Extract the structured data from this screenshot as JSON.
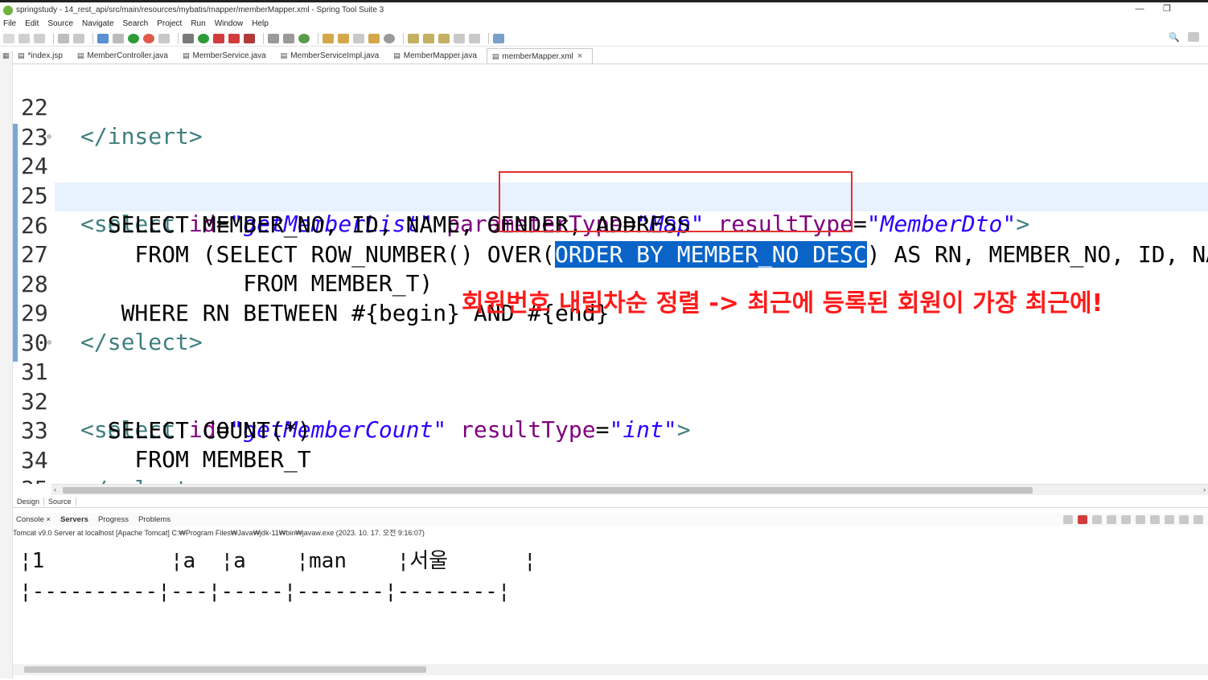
{
  "window": {
    "title": "springstudy - 14_rest_api/src/main/resources/mybatis/mapper/memberMapper.xml - Spring Tool Suite 3",
    "controls": [
      "—",
      "❐",
      ""
    ]
  },
  "menu": [
    "File",
    "Edit",
    "Source",
    "Navigate",
    "Search",
    "Project",
    "Run",
    "Window",
    "Help"
  ],
  "tabs": [
    {
      "label": "*index.jsp",
      "icon": "jsp-file-icon",
      "active": false
    },
    {
      "label": "MemberController.java",
      "icon": "java-file-icon",
      "active": false
    },
    {
      "label": "MemberService.java",
      "icon": "java-file-icon",
      "active": false
    },
    {
      "label": "MemberServiceImpl.java",
      "icon": "java-file-icon",
      "active": false
    },
    {
      "label": "MemberMapper.java",
      "icon": "java-file-icon",
      "active": false
    },
    {
      "label": "memberMapper.xml",
      "icon": "xml-file-icon",
      "active": true
    }
  ],
  "editor": {
    "lines": [
      {
        "n": "22",
        "code": "</insert>"
      },
      {
        "n": "23",
        "code": ""
      },
      {
        "n": "24",
        "code": "<select id=\"getMemberList\" parameterType=\"Map\" resultType=\"MemberDto\">"
      },
      {
        "n": "25",
        "code": "  SELECT MEMBER_NO, ID, NAME, GENDER, ADDRESS"
      },
      {
        "n": "26",
        "code": "    FROM (SELECT ROW_NUMBER() OVER(ORDER BY MEMBER_NO DESC) AS RN, MEMBER_NO, ID, NAME,"
      },
      {
        "n": "27",
        "code": "            FROM MEMBER_T)"
      },
      {
        "n": "28",
        "code": "   WHERE RN BETWEEN #{begin} AND #{end}"
      },
      {
        "n": "29",
        "code": "</select>"
      },
      {
        "n": "30",
        "code": ""
      },
      {
        "n": "31",
        "code": "<select id=\"getMemberCount\" resultType=\"int\">"
      },
      {
        "n": "32",
        "code": "  SELECT COUNT(*)"
      },
      {
        "n": "33",
        "code": "    FROM MEMBER_T"
      },
      {
        "n": "34",
        "code": "</select>"
      },
      {
        "n": "35",
        "code": ""
      }
    ],
    "selected_text": "ORDER BY MEMBER_NO DESC"
  },
  "annotation": {
    "text": "회원번호 내림차순 정렬 -> 최근에 등록된 회원이 가장 최근에!",
    "color": "#ff1a1a"
  },
  "design_tabs": [
    "Design",
    "Source"
  ],
  "view_tabs": [
    "Console",
    "Servers",
    "Progress",
    "Problems"
  ],
  "launch_info": "Tomcat v9.0 Server at localhost [Apache Tomcat] C:₩Program Files₩Java₩jdk-11₩bin₩javaw.exe  (2023. 10. 17. 오전 9:16:07)",
  "console_rows": [
    "¦1          ¦a  ¦a    ¦man    ¦서울      ¦",
    "¦----------¦---¦-----¦-------¦--------¦"
  ],
  "colors": {
    "selection": "#0a64c8",
    "tag": "#3f7f7f",
    "attribute": "#7f007f",
    "string": "#2a00ff",
    "annotation_box": "#e53030"
  }
}
